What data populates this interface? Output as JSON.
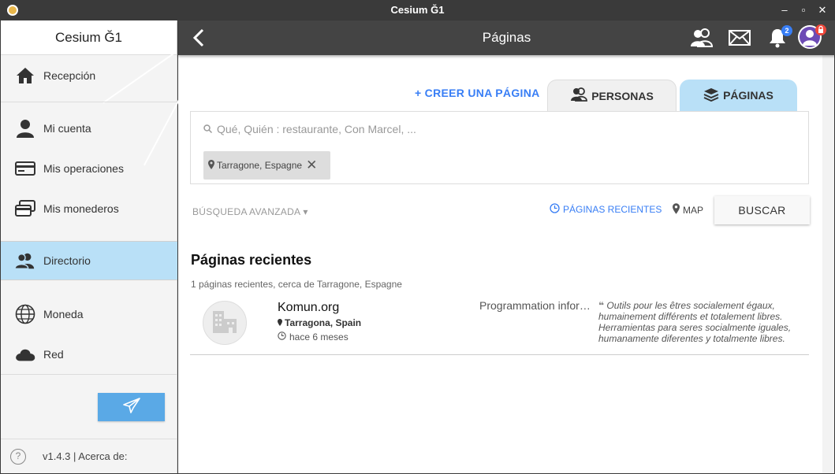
{
  "window": {
    "title": "Cesium Ğ1"
  },
  "sidebar": {
    "title": "Cesium Ğ1",
    "items": [
      {
        "label": "Recepción",
        "icon": "home-icon"
      },
      {
        "label": "Mi cuenta",
        "icon": "person-icon"
      },
      {
        "label": "Mis operaciones",
        "icon": "card-icon"
      },
      {
        "label": "Mis monederos",
        "icon": "cards-icon"
      },
      {
        "label": "Directorio",
        "icon": "people-icon"
      },
      {
        "label": "Moneda",
        "icon": "globe-icon"
      },
      {
        "label": "Red",
        "icon": "cloud-icon"
      }
    ],
    "active": "Directorio",
    "footer": {
      "help": "?",
      "version_text": "v1.4.3 | Acerca de:"
    }
  },
  "header": {
    "title": "Páginas",
    "notification_count": "2"
  },
  "main": {
    "create_label": "CREER UNA PÁGINA",
    "tabs": [
      {
        "label": "PERSONAS"
      },
      {
        "label": "PÁGINAS"
      }
    ],
    "search": {
      "placeholder": "Qué, Quién : restaurante, Con Marcel, ...",
      "location_chip": "Tarragone, Espagne"
    },
    "advanced_label": "BÚSQUEDA AVANZADA",
    "recent_label": "PÁGINAS RECIENTES",
    "map_label": "MAP",
    "search_button": "BUSCAR",
    "section_title": "Páginas recientes",
    "section_subtitle": "1 páginas recientes, cerca de Tarragone, Espagne",
    "results": [
      {
        "name": "Komun.org",
        "location": "Tarragona, Spain",
        "time": "hace 6 meses",
        "category": "Programmation informatique",
        "description": "Outils pour les êtres socialement égaux, humainement différents et totalement libres. Herramientas para seres socialmente iguales, humanamente diferentes y totalmente libres."
      }
    ]
  },
  "colors": {
    "accent": "#387ef5",
    "active_bg": "#b9e0f7",
    "header_bg": "#444444"
  }
}
